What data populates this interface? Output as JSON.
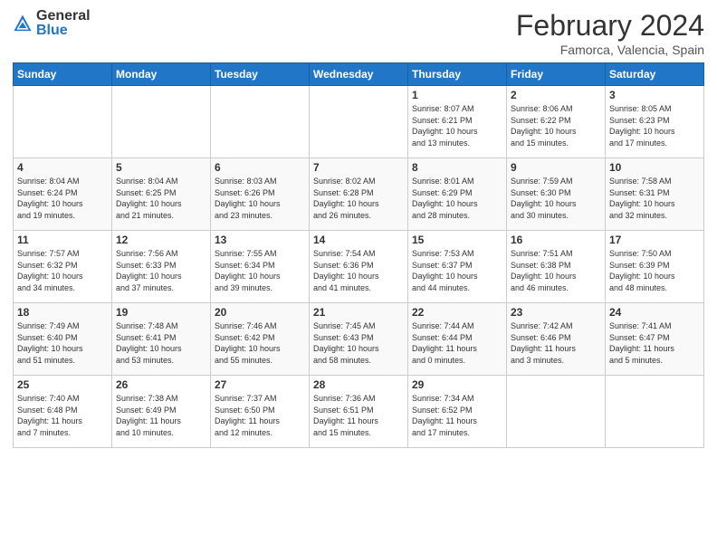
{
  "header": {
    "logo_general": "General",
    "logo_blue": "Blue",
    "title": "February 2024",
    "subtitle": "Famorca, Valencia, Spain"
  },
  "days_of_week": [
    "Sunday",
    "Monday",
    "Tuesday",
    "Wednesday",
    "Thursday",
    "Friday",
    "Saturday"
  ],
  "weeks": [
    [
      {
        "day": "",
        "info": ""
      },
      {
        "day": "",
        "info": ""
      },
      {
        "day": "",
        "info": ""
      },
      {
        "day": "",
        "info": ""
      },
      {
        "day": "1",
        "info": "Sunrise: 8:07 AM\nSunset: 6:21 PM\nDaylight: 10 hours\nand 13 minutes."
      },
      {
        "day": "2",
        "info": "Sunrise: 8:06 AM\nSunset: 6:22 PM\nDaylight: 10 hours\nand 15 minutes."
      },
      {
        "day": "3",
        "info": "Sunrise: 8:05 AM\nSunset: 6:23 PM\nDaylight: 10 hours\nand 17 minutes."
      }
    ],
    [
      {
        "day": "4",
        "info": "Sunrise: 8:04 AM\nSunset: 6:24 PM\nDaylight: 10 hours\nand 19 minutes."
      },
      {
        "day": "5",
        "info": "Sunrise: 8:04 AM\nSunset: 6:25 PM\nDaylight: 10 hours\nand 21 minutes."
      },
      {
        "day": "6",
        "info": "Sunrise: 8:03 AM\nSunset: 6:26 PM\nDaylight: 10 hours\nand 23 minutes."
      },
      {
        "day": "7",
        "info": "Sunrise: 8:02 AM\nSunset: 6:28 PM\nDaylight: 10 hours\nand 26 minutes."
      },
      {
        "day": "8",
        "info": "Sunrise: 8:01 AM\nSunset: 6:29 PM\nDaylight: 10 hours\nand 28 minutes."
      },
      {
        "day": "9",
        "info": "Sunrise: 7:59 AM\nSunset: 6:30 PM\nDaylight: 10 hours\nand 30 minutes."
      },
      {
        "day": "10",
        "info": "Sunrise: 7:58 AM\nSunset: 6:31 PM\nDaylight: 10 hours\nand 32 minutes."
      }
    ],
    [
      {
        "day": "11",
        "info": "Sunrise: 7:57 AM\nSunset: 6:32 PM\nDaylight: 10 hours\nand 34 minutes."
      },
      {
        "day": "12",
        "info": "Sunrise: 7:56 AM\nSunset: 6:33 PM\nDaylight: 10 hours\nand 37 minutes."
      },
      {
        "day": "13",
        "info": "Sunrise: 7:55 AM\nSunset: 6:34 PM\nDaylight: 10 hours\nand 39 minutes."
      },
      {
        "day": "14",
        "info": "Sunrise: 7:54 AM\nSunset: 6:36 PM\nDaylight: 10 hours\nand 41 minutes."
      },
      {
        "day": "15",
        "info": "Sunrise: 7:53 AM\nSunset: 6:37 PM\nDaylight: 10 hours\nand 44 minutes."
      },
      {
        "day": "16",
        "info": "Sunrise: 7:51 AM\nSunset: 6:38 PM\nDaylight: 10 hours\nand 46 minutes."
      },
      {
        "day": "17",
        "info": "Sunrise: 7:50 AM\nSunset: 6:39 PM\nDaylight: 10 hours\nand 48 minutes."
      }
    ],
    [
      {
        "day": "18",
        "info": "Sunrise: 7:49 AM\nSunset: 6:40 PM\nDaylight: 10 hours\nand 51 minutes."
      },
      {
        "day": "19",
        "info": "Sunrise: 7:48 AM\nSunset: 6:41 PM\nDaylight: 10 hours\nand 53 minutes."
      },
      {
        "day": "20",
        "info": "Sunrise: 7:46 AM\nSunset: 6:42 PM\nDaylight: 10 hours\nand 55 minutes."
      },
      {
        "day": "21",
        "info": "Sunrise: 7:45 AM\nSunset: 6:43 PM\nDaylight: 10 hours\nand 58 minutes."
      },
      {
        "day": "22",
        "info": "Sunrise: 7:44 AM\nSunset: 6:44 PM\nDaylight: 11 hours\nand 0 minutes."
      },
      {
        "day": "23",
        "info": "Sunrise: 7:42 AM\nSunset: 6:46 PM\nDaylight: 11 hours\nand 3 minutes."
      },
      {
        "day": "24",
        "info": "Sunrise: 7:41 AM\nSunset: 6:47 PM\nDaylight: 11 hours\nand 5 minutes."
      }
    ],
    [
      {
        "day": "25",
        "info": "Sunrise: 7:40 AM\nSunset: 6:48 PM\nDaylight: 11 hours\nand 7 minutes."
      },
      {
        "day": "26",
        "info": "Sunrise: 7:38 AM\nSunset: 6:49 PM\nDaylight: 11 hours\nand 10 minutes."
      },
      {
        "day": "27",
        "info": "Sunrise: 7:37 AM\nSunset: 6:50 PM\nDaylight: 11 hours\nand 12 minutes."
      },
      {
        "day": "28",
        "info": "Sunrise: 7:36 AM\nSunset: 6:51 PM\nDaylight: 11 hours\nand 15 minutes."
      },
      {
        "day": "29",
        "info": "Sunrise: 7:34 AM\nSunset: 6:52 PM\nDaylight: 11 hours\nand 17 minutes."
      },
      {
        "day": "",
        "info": ""
      },
      {
        "day": "",
        "info": ""
      }
    ]
  ]
}
